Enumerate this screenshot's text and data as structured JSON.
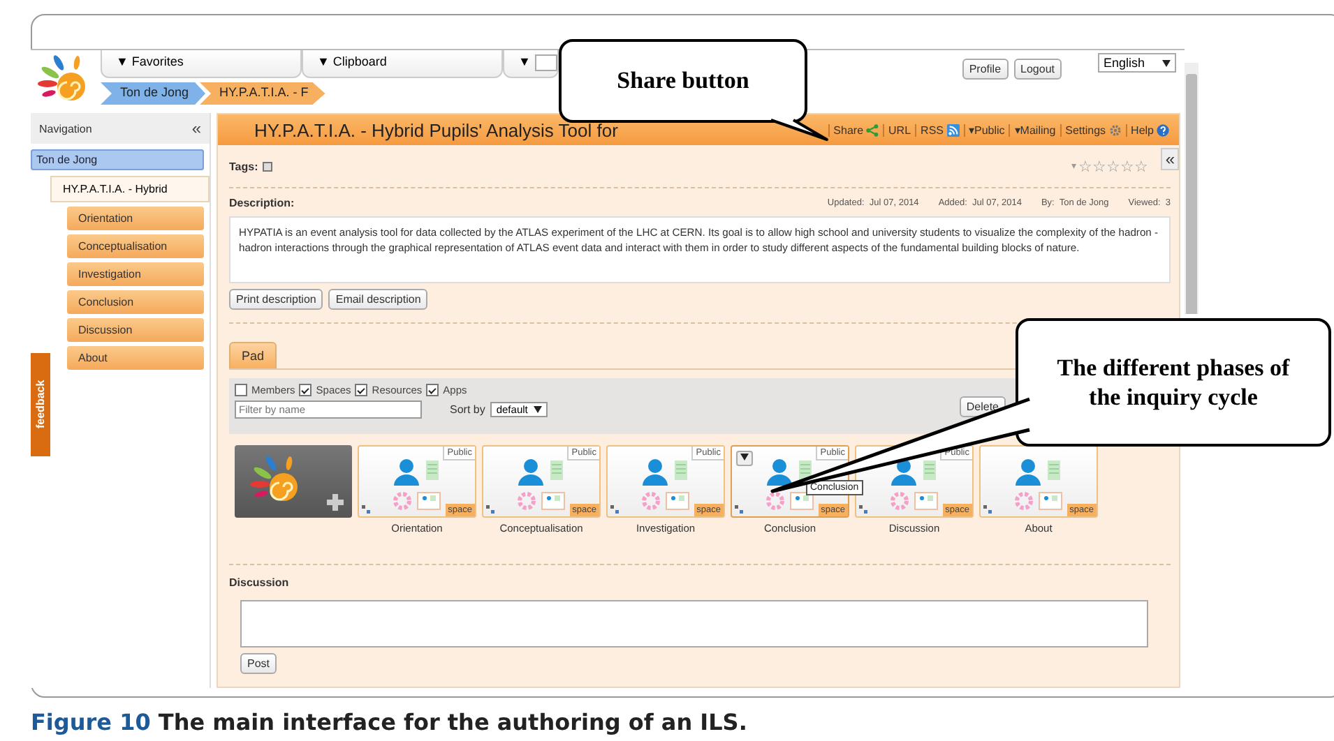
{
  "header": {
    "menus": [
      {
        "label": "▼ Favorites",
        "field": false
      },
      {
        "label": "▼ Clipboard",
        "field": false
      },
      {
        "label": "▼",
        "field": true
      }
    ],
    "buttons": [
      "Profile",
      "Logout"
    ],
    "language": "English"
  },
  "breadcrumbs": [
    {
      "label": "Ton de Jong",
      "color": "#7fb2e8"
    },
    {
      "label": "HY.P.A.T.I.A. - F",
      "color": "#f7b060"
    }
  ],
  "navigation": {
    "title": "Navigation",
    "collapse": "«",
    "tree": [
      {
        "label": "Ton de Jong",
        "selected": true,
        "children": [
          {
            "label": "HY.P.A.T.I.A. - Hybrid",
            "selected": false,
            "children": [
              {
                "label": "Orientation",
                "selected": false
              },
              {
                "label": "Conceptualisation",
                "selected": false
              },
              {
                "label": "Investigation",
                "selected": false
              },
              {
                "label": "Conclusion",
                "selected": false
              },
              {
                "label": "Discussion",
                "selected": false
              },
              {
                "label": "About",
                "selected": false
              }
            ]
          }
        ]
      }
    ]
  },
  "feedback": "feedback",
  "page": {
    "title": "HY.P.A.T.I.A. - Hybrid Pupils' Analysis Tool for",
    "actions": [
      {
        "label": "Share",
        "kind": "share"
      },
      {
        "label": "URL",
        "kind": "plain"
      },
      {
        "label": "RSS",
        "kind": "rss"
      },
      {
        "label": "▾Public",
        "kind": "plain"
      },
      {
        "label": "▾Mailing",
        "kind": "plain"
      },
      {
        "label": "Settings",
        "kind": "gear"
      },
      {
        "label": "Help",
        "kind": "help"
      }
    ],
    "collapse": "«",
    "tags_label": "Tags:",
    "rating_menu": "▾",
    "stars": 0,
    "description_label": "Description:",
    "meta": [
      "Updated:  Jul 07, 2014",
      "Added:  Jul 07, 2014",
      "By:  Ton de Jong",
      "Viewed:  3"
    ],
    "description": "HYPATIA is an event analysis tool for data collected by the ATLAS experiment of the LHC at CERN. Its goal is to allow high school and university students to visualize the complexity of the hadron - hadron interactions through the graphical representation of ATLAS event data and interact with them in order to study different aspects of the fundamental building blocks of nature.",
    "description_buttons": [
      "Print description",
      "Email description"
    ]
  },
  "pad": {
    "tabs": [
      {
        "label": "Pad",
        "selected": true
      }
    ],
    "filters": [
      {
        "label": "Members",
        "checked": false
      },
      {
        "label": "Spaces",
        "checked": true
      },
      {
        "label": "Resources",
        "checked": true
      },
      {
        "label": "Apps",
        "checked": true
      }
    ],
    "filter_placeholder": "Filter by name",
    "sort_label": "Sort by",
    "sort_value": "default",
    "delete_button": "Delete",
    "items": [
      {
        "label": "Orientation",
        "badge": "Public",
        "tag": "space",
        "menu": false
      },
      {
        "label": "Conceptualisation",
        "badge": "Public",
        "tag": "space",
        "menu": false
      },
      {
        "label": "Investigation",
        "badge": "Public",
        "tag": "space",
        "menu": false
      },
      {
        "label": "Conclusion",
        "badge": "Public",
        "tag": "space",
        "menu": true,
        "tooltip": "Conclusion"
      },
      {
        "label": "Discussion",
        "badge": "Public",
        "tag": "space",
        "menu": false
      },
      {
        "label": "About",
        "tag": "space",
        "menu": false
      }
    ]
  },
  "discussion": {
    "label": "Discussion",
    "button": "Post"
  },
  "callouts": [
    {
      "text": "Share button",
      "kind": "share"
    },
    {
      "text": "The different phases of the inquiry cycle",
      "kind": "phases"
    }
  ],
  "caption": {
    "label": "Figure 10",
    "text": "The main interface for the authoring of an ILS."
  }
}
